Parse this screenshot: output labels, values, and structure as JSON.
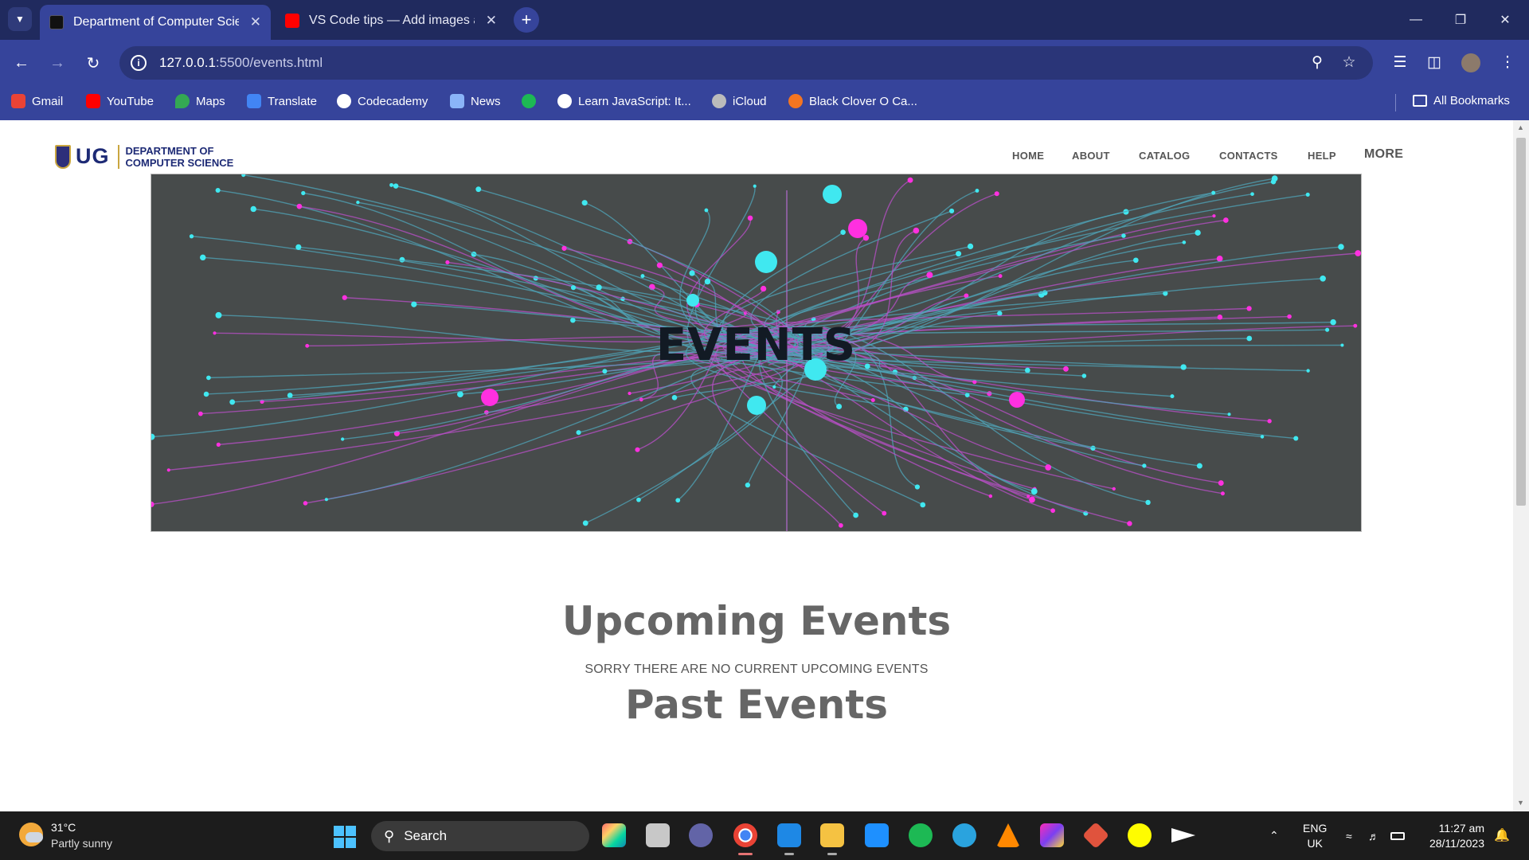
{
  "browser": {
    "tabs": [
      {
        "title": "Department of Computer Scien",
        "active": true
      },
      {
        "title": "VS Code tips — Add images an",
        "active": false
      }
    ],
    "url_host": "127.0.0.1",
    "url_path": ":5500/events.html",
    "bookmarks": [
      {
        "label": "Gmail",
        "icon": "gmail-icon",
        "color": "#ea4335"
      },
      {
        "label": "YouTube",
        "icon": "youtube-icon",
        "color": "#ff0000"
      },
      {
        "label": "Maps",
        "icon": "maps-icon",
        "color": "#34a853"
      },
      {
        "label": "Translate",
        "icon": "translate-icon",
        "color": "#4285f4"
      },
      {
        "label": "Codecademy",
        "icon": "globe-icon",
        "color": "#ffffff"
      },
      {
        "label": "News",
        "icon": "news-icon",
        "color": "#8ab4f8"
      },
      {
        "label": "",
        "icon": "spotify-icon",
        "color": "#1db954"
      },
      {
        "label": "Learn JavaScript: It...",
        "icon": "globe-icon",
        "color": "#ffffff"
      },
      {
        "label": "iCloud",
        "icon": "apple-icon",
        "color": "#bbbbbb"
      },
      {
        "label": "Black Clover O Ca...",
        "icon": "crunchyroll-icon",
        "color": "#f47521"
      }
    ],
    "all_bookmarks": "All Bookmarks"
  },
  "site": {
    "logo_ug": "UG",
    "logo_dept_line1": "DEPARTMENT OF",
    "logo_dept_line2": "COMPUTER SCIENCE",
    "nav": [
      "HOME",
      "ABOUT",
      "CATALOG",
      "CONTACTS",
      "HELP",
      "MORE"
    ],
    "hero_title": "EVENTS",
    "upcoming_heading": "Upcoming Events",
    "no_events_text": "SORRY THERE ARE NO CURRENT UPCOMING EVENTS",
    "past_heading": "Past Events"
  },
  "taskbar": {
    "temperature": "31°C",
    "condition": "Partly sunny",
    "search_placeholder": "Search",
    "lang_1": "ENG",
    "lang_2": "UK",
    "time": "11:27 am",
    "date": "28/11/2023"
  },
  "colors": {
    "chrome_dark": "#202a5e",
    "chrome_accent": "#36449b",
    "hero_bg": "#474b4b",
    "cyan_node": "#40e8f0",
    "magenta_node": "#ff30e0"
  }
}
